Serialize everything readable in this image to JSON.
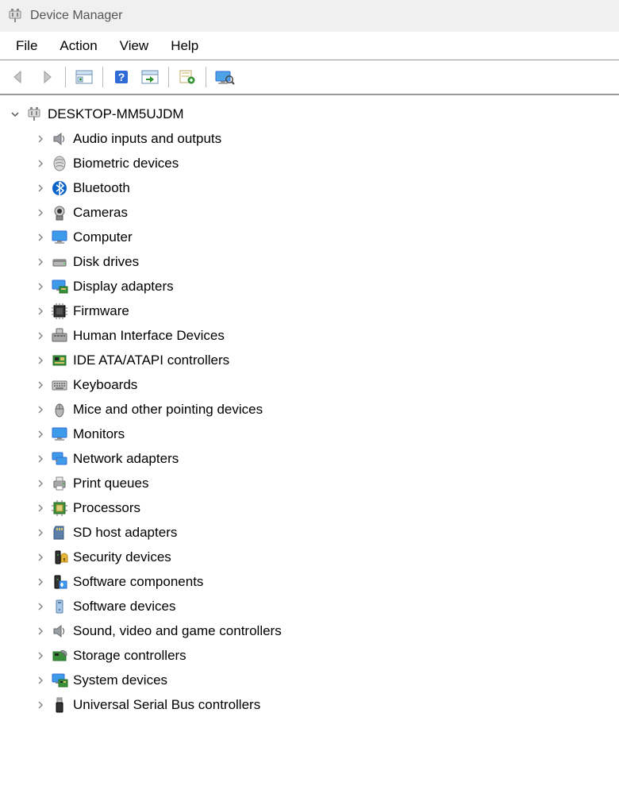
{
  "window": {
    "title": "Device Manager"
  },
  "menubar": {
    "file": "File",
    "action": "Action",
    "view": "View",
    "help": "Help"
  },
  "tree": {
    "root": "DESKTOP-MM5UJDM",
    "items": [
      {
        "label": "Audio inputs and outputs",
        "icon": "speaker"
      },
      {
        "label": "Biometric devices",
        "icon": "fingerprint"
      },
      {
        "label": "Bluetooth",
        "icon": "bluetooth"
      },
      {
        "label": "Cameras",
        "icon": "camera"
      },
      {
        "label": "Computer",
        "icon": "monitor"
      },
      {
        "label": "Disk drives",
        "icon": "disk"
      },
      {
        "label": "Display adapters",
        "icon": "display-adapter"
      },
      {
        "label": "Firmware",
        "icon": "chip"
      },
      {
        "label": "Human Interface Devices",
        "icon": "hid"
      },
      {
        "label": "IDE ATA/ATAPI controllers",
        "icon": "ide"
      },
      {
        "label": "Keyboards",
        "icon": "keyboard"
      },
      {
        "label": "Mice and other pointing devices",
        "icon": "mouse"
      },
      {
        "label": "Monitors",
        "icon": "monitor"
      },
      {
        "label": "Network adapters",
        "icon": "network"
      },
      {
        "label": "Print queues",
        "icon": "printer"
      },
      {
        "label": "Processors",
        "icon": "cpu"
      },
      {
        "label": "SD host adapters",
        "icon": "sd"
      },
      {
        "label": "Security devices",
        "icon": "security"
      },
      {
        "label": "Software components",
        "icon": "soft-comp"
      },
      {
        "label": "Software devices",
        "icon": "soft-dev"
      },
      {
        "label": "Sound, video and game controllers",
        "icon": "speaker"
      },
      {
        "label": "Storage controllers",
        "icon": "storage"
      },
      {
        "label": "System devices",
        "icon": "system"
      },
      {
        "label": "Universal Serial Bus controllers",
        "icon": "usb"
      }
    ]
  }
}
